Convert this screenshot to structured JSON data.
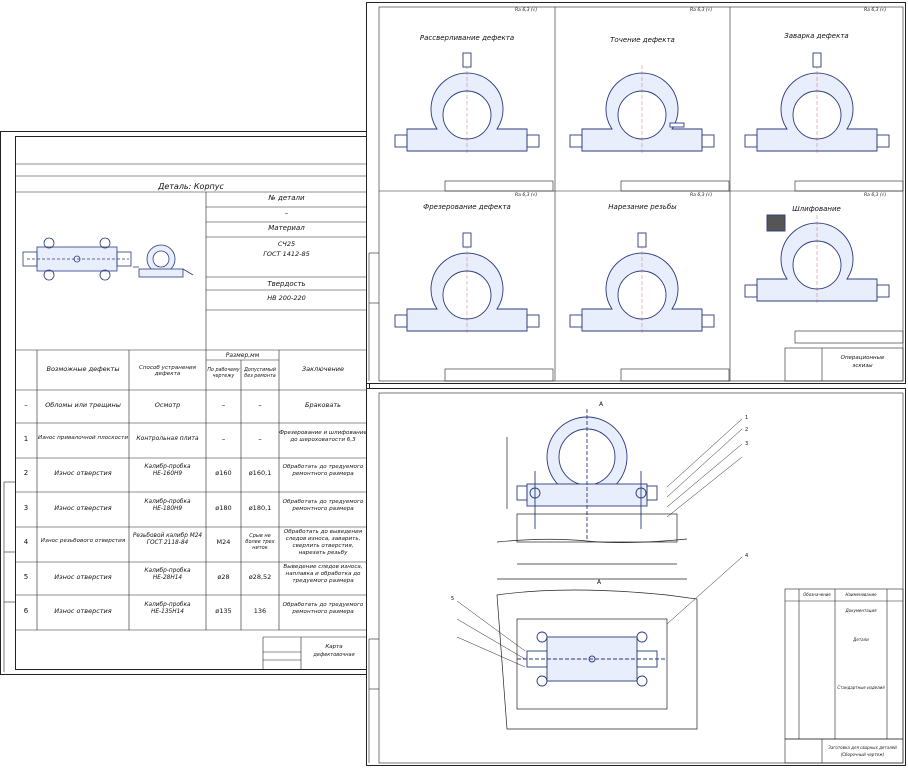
{
  "card": {
    "detail": "Деталь: Корпус",
    "part_no": "№ детали",
    "dash": "–",
    "material_lbl": "Материал",
    "material_val1": "СЧ25",
    "material_val2": "ГОСТ 1412-85",
    "hardness_lbl": "Твердость",
    "hardness_val": "НВ 200-220",
    "headers": {
      "defects": "Возможные дефекты",
      "method": "Способ устранения дефекта",
      "size": "Размер,мм",
      "by_drawing": "По рабочему чертежу",
      "allowed": "Допустимый без ремонта",
      "conclusion": "Заключение"
    },
    "rows": [
      {
        "n": "–",
        "defect": "Обломы или трещины",
        "method": "Осмотр",
        "draw": "–",
        "allow": "–",
        "concl": "Браковать"
      },
      {
        "n": "1",
        "defect": "Износ привалочной плоскости",
        "method": "Контрольная плита",
        "draw": "–",
        "allow": "–",
        "concl": "Фрезерование и шлифование до шероховатости 6,3"
      },
      {
        "n": "2",
        "defect": "Износ отверстия",
        "method": "Калибр-пробка НЕ-160Н9",
        "draw": "ø160",
        "allow": "ø160,1",
        "concl": "Обработать до тредуемого ремонтного размера"
      },
      {
        "n": "3",
        "defect": "Износ отверстия",
        "method": "Калибр-пробка НЕ-180Н9",
        "draw": "ø180",
        "allow": "ø180,1",
        "concl": "Обработать до тредуемого ремонтного размера"
      },
      {
        "n": "4",
        "defect": "Износ резьбового отверстия",
        "method": "Резьбовой калибр М24 ГОСТ 2118-84",
        "draw": "М24",
        "allow": "Срыв не более трех ниток",
        "concl": "Обработать до выведения следов износа, заварить, сверлить отверстия, нарезать резьбу"
      },
      {
        "n": "5",
        "defect": "Износ отверстия",
        "method": "Калибр-пробка НЕ-28Н14",
        "draw": "ø28",
        "allow": "ø28,52",
        "concl": "Выведение следов износа, наплавка и обработка до тредуемого размера"
      },
      {
        "n": "6",
        "defect": "Износ отверстия",
        "method": "Калибр-пробка НЕ-135Н14",
        "draw": "ø135",
        "allow": "136",
        "concl": "Обработать до тредуемого ремонтного размера"
      }
    ],
    "stamp1": "Карта",
    "stamp2": "дефектовочная"
  },
  "ops": {
    "titles": [
      "Рассверливание дефекта",
      "Точение дефекта",
      "Заварка дефекта",
      "Фрезерование дефекта",
      "Нарезание резьбы",
      "Шлифование"
    ],
    "ra": "Ra 6,3 (√)",
    "stamp1": "Операционные",
    "stamp2": "эскизы"
  },
  "assembly": {
    "label_a": "А",
    "label_a2": "А",
    "callouts": [
      "1",
      "2",
      "3",
      "4",
      "5"
    ],
    "stamp1": "Заготовка для сварных деталей",
    "stamp2": "(Сборочный чертеж)",
    "spec_header": [
      "Обозначение",
      "Наименование"
    ],
    "spec_sections": [
      "Документация",
      "Детали",
      "Стандартные изделия"
    ]
  }
}
